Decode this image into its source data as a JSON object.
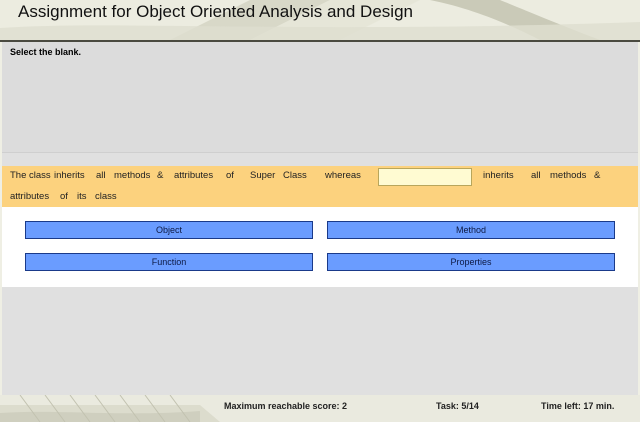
{
  "header": {
    "title": "Assignment for Object Oriented Analysis and Design"
  },
  "question": {
    "instruction": "Select the blank.",
    "sentence_line1_words": [
      "The",
      "class",
      "inherits",
      "all",
      "methods",
      "&",
      "attributes",
      "of",
      "Super",
      "Class",
      "whereas"
    ],
    "blank_value": "",
    "sentence_line1_after": [
      "inherits",
      "all",
      "methods",
      "&"
    ],
    "sentence_line2_words": [
      "attributes",
      "of",
      "its",
      "class"
    ]
  },
  "answers": [
    {
      "label": "Object"
    },
    {
      "label": "Method"
    },
    {
      "label": "Function"
    },
    {
      "label": "Properties"
    }
  ],
  "footer": {
    "max_score": "Maximum reachable score: 2",
    "task": "Task: 5/14",
    "time_left_prefix": "Time left:",
    "time_left_value": "17",
    "time_left_unit": "min."
  },
  "colors": {
    "band": "#fcd27e",
    "button": "#6a9cff",
    "blank": "#fffbd2"
  }
}
